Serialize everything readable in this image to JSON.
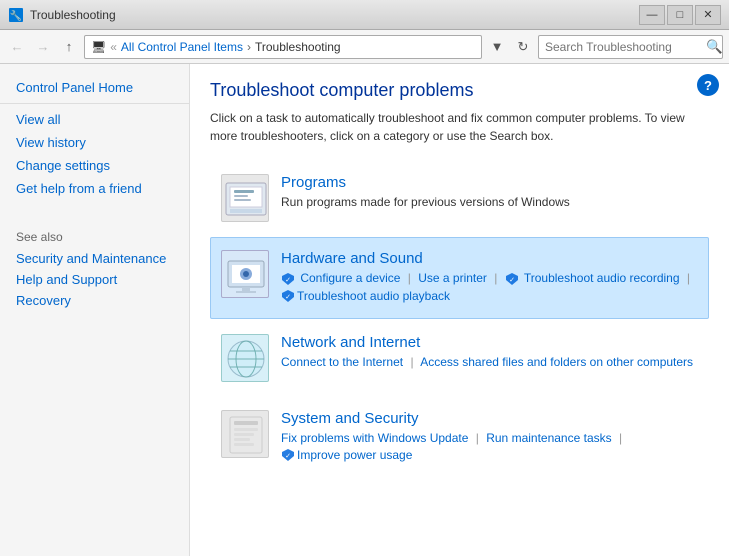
{
  "window": {
    "title": "Troubleshooting",
    "min_btn": "—",
    "max_btn": "□",
    "close_btn": "✕"
  },
  "address": {
    "back_title": "Back",
    "forward_title": "Forward",
    "up_title": "Up",
    "breadcrumb_home": "All Control Panel Items",
    "breadcrumb_sep": "›",
    "breadcrumb_current": "Troubleshooting",
    "refresh_title": "Refresh",
    "search_placeholder": "Search Troubleshooting",
    "search_icon": "🔍"
  },
  "sidebar": {
    "control_panel_home": "Control Panel Home",
    "view_all": "View all",
    "view_history": "View history",
    "change_settings": "Change settings",
    "get_help": "Get help from a friend",
    "see_also_label": "See also",
    "security_maintenance": "Security and Maintenance",
    "help_support": "Help and Support",
    "recovery": "Recovery"
  },
  "content": {
    "title": "Troubleshoot computer problems",
    "description": "Click on a task to automatically troubleshoot and fix common computer problems. To view more troubleshooters, click on a category or use the Search box.",
    "help_symbol": "?",
    "categories": [
      {
        "id": "programs",
        "title": "Programs",
        "subtitle": "Run programs made for previous versions of Windows",
        "links": []
      },
      {
        "id": "hardware",
        "title": "Hardware and Sound",
        "subtitle": "",
        "links": [
          {
            "text": "Configure a device",
            "shield": true
          },
          {
            "text": "Use a printer",
            "shield": false
          },
          {
            "text": "Troubleshoot audio recording",
            "shield": false
          }
        ],
        "links2": [
          {
            "text": "Troubleshoot audio playback",
            "shield": true
          }
        ],
        "selected": true
      },
      {
        "id": "network",
        "title": "Network and Internet",
        "subtitle": "",
        "links": [
          {
            "text": "Connect to the Internet",
            "shield": false
          },
          {
            "text": "Access shared files and folders on other computers",
            "shield": false
          }
        ]
      },
      {
        "id": "security",
        "title": "System and Security",
        "subtitle": "",
        "links": [
          {
            "text": "Fix problems with Windows Update",
            "shield": false
          },
          {
            "text": "Run maintenance tasks",
            "shield": false
          }
        ],
        "links2": [
          {
            "text": "Improve power usage",
            "shield": true
          }
        ]
      }
    ]
  }
}
